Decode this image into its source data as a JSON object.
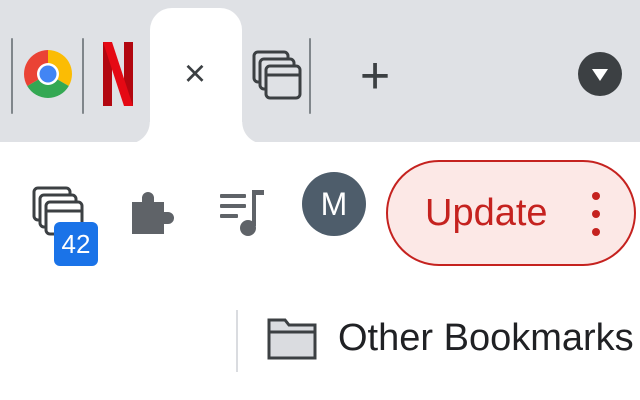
{
  "tabs": [
    {
      "name": "Google Chrome",
      "icon": "chrome-logo-icon",
      "active": false
    },
    {
      "name": "Netflix",
      "icon": "netflix-logo-icon",
      "active": false
    },
    {
      "name": "",
      "icon": "close-icon",
      "active": true
    },
    {
      "name": "",
      "icon": "tab-group-icon",
      "active": false
    }
  ],
  "tabstrip": {
    "close_glyph": "×",
    "new_tab_glyph": "+",
    "tab_search_icon": "chevron-down-icon"
  },
  "toolbar": {
    "tab_counter_badge": "42",
    "extensions_icon": "puzzle-piece-icon",
    "media_icon": "playlist-music-icon",
    "avatar_initial": "M",
    "update_label": "Update"
  },
  "bookmarks": {
    "other_bookmarks_label": "Other Bookmarks",
    "folder_icon": "folder-icon"
  },
  "colors": {
    "tabstrip_bg": "#dfe1e5",
    "update_text": "#c5221f",
    "update_bg": "#fce8e6",
    "badge_bg": "#1a73e8",
    "avatar_bg": "#4e5d6b"
  }
}
